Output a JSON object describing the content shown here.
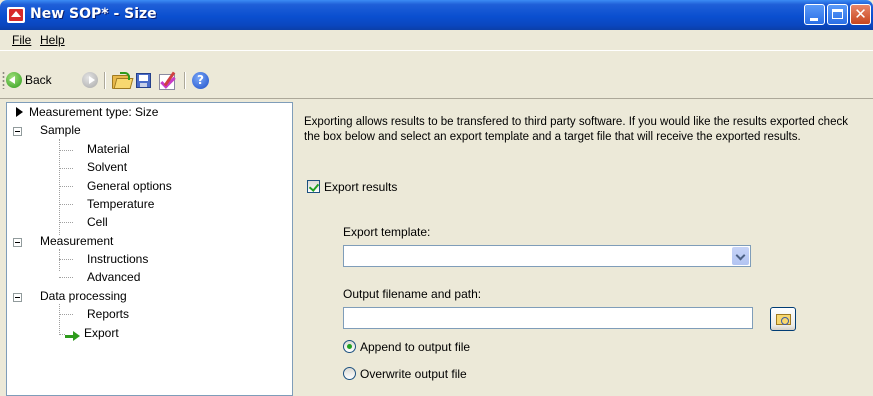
{
  "window": {
    "title": "New SOP* - Size"
  },
  "menu": {
    "file": "File",
    "help": "Help"
  },
  "toolbar": {
    "back_label": "Back"
  },
  "tree": {
    "measurement_type": "Measurement type: Size",
    "sample": "Sample",
    "material": "Material",
    "solvent": "Solvent",
    "general_options": "General options",
    "temperature": "Temperature",
    "cell": "Cell",
    "measurement": "Measurement",
    "instructions": "Instructions",
    "advanced": "Advanced",
    "data_processing": "Data processing",
    "reports": "Reports",
    "export": "Export"
  },
  "export_panel": {
    "description": "Exporting allows results to be transfered to third party software.  If you would like the results exported check the box below and select an export template and a target file that will receive the exported results.",
    "export_results_label": "Export results",
    "export_results_checked": true,
    "export_template_label": "Export template:",
    "export_template_value": "",
    "output_filename_label": "Output filename and path:",
    "output_filename_value": "",
    "append_label": "Append to output file",
    "overwrite_label": "Overwrite output file",
    "selected_mode": "append"
  },
  "colors": {
    "titlebar": "#0A4FD0",
    "window_bg": "#ECE9D8",
    "check_green": "#21A121"
  },
  "icons": [
    "app-icon",
    "minimize-icon",
    "maximize-icon",
    "close-icon",
    "back-arrow-icon",
    "forward-arrow-icon",
    "open-folder-icon",
    "save-icon",
    "edit-icon",
    "help-icon",
    "tree-expand-icon",
    "tree-arrow-icon",
    "browse-folder-icon",
    "dropdown-chevron-icon"
  ]
}
